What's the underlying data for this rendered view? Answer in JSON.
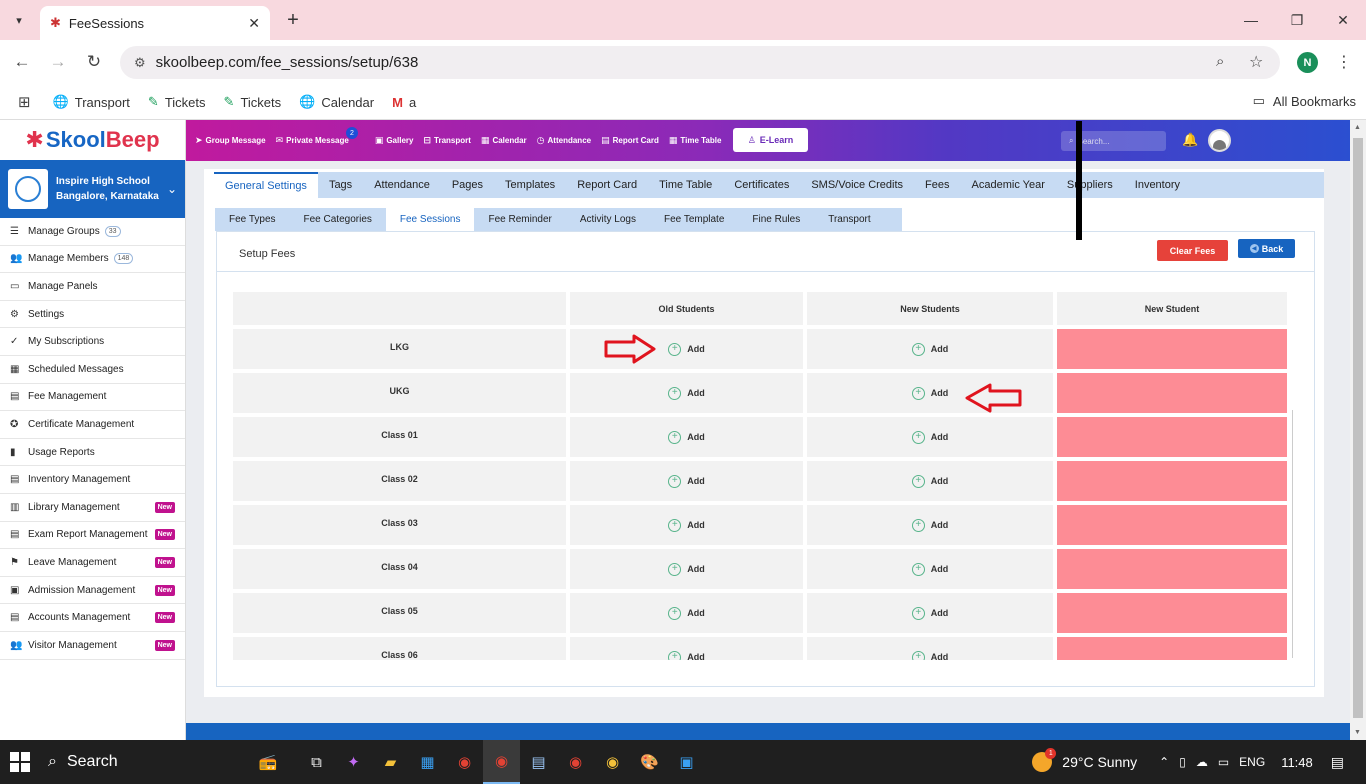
{
  "browser": {
    "tab_title": "FeeSessions",
    "url": "skoolbeep.com/fee_sessions/setup/638",
    "profile_initial": "N",
    "bookmarks": [
      "Transport",
      "Tickets",
      "Tickets",
      "Calendar",
      "a"
    ],
    "all_bookmarks": "All Bookmarks"
  },
  "app": {
    "logo_part1": "Skool",
    "logo_part2": "Beep",
    "school_name": "Inspire High School",
    "school_location": "Bangalore, Karnataka",
    "sidebar": [
      {
        "label": "Manage Groups",
        "count": "33",
        "icon": "list-icon"
      },
      {
        "label": "Manage Members",
        "count": "148",
        "icon": "users-icon"
      },
      {
        "label": "Manage Panels",
        "icon": "monitor-icon"
      },
      {
        "label": "Settings",
        "icon": "gear-icon"
      },
      {
        "label": "My Subscriptions",
        "icon": "check-icon"
      },
      {
        "label": "Scheduled Messages",
        "icon": "calendar-icon"
      },
      {
        "label": "Fee Management",
        "icon": "receipt-icon"
      },
      {
        "label": "Certificate Management",
        "icon": "ribbon-icon"
      },
      {
        "label": "Usage Reports",
        "icon": "bar-chart-icon"
      },
      {
        "label": "Inventory Management",
        "icon": "inventory-icon"
      },
      {
        "label": "Library Management",
        "badge": "New",
        "icon": "book-icon"
      },
      {
        "label": "Exam Report Management",
        "badge": "New",
        "icon": "report-icon"
      },
      {
        "label": "Leave Management",
        "badge": "New",
        "icon": "leave-icon"
      },
      {
        "label": "Admission Management",
        "badge": "New",
        "icon": "admission-icon"
      },
      {
        "label": "Accounts Management",
        "badge": "New",
        "icon": "accounts-icon"
      },
      {
        "label": "Visitor Management",
        "badge": "New",
        "icon": "visitor-icon"
      }
    ],
    "topnav": {
      "group_message": "Group Message",
      "private_message": "Private Message",
      "private_message_count": "2",
      "gallery": "Gallery",
      "transport": "Transport",
      "calendar": "Calendar",
      "attendance": "Attendance",
      "report_card": "Report Card",
      "time_table": "Time Table",
      "elearn": "E-Learn",
      "search_placeholder": "Search..."
    },
    "general_tabs": [
      "General Settings",
      "Tags",
      "Attendance",
      "Pages",
      "Templates",
      "Report Card",
      "Time Table",
      "Certificates",
      "SMS/Voice Credits",
      "Fees",
      "Academic Year",
      "Suppliers",
      "Inventory"
    ],
    "fee_tabs": [
      "Fee Types",
      "Fee Categories",
      "Fee Sessions",
      "Fee Reminder",
      "Activity Logs",
      "Fee Template",
      "Fine Rules",
      "Transport"
    ],
    "setup_title": "Setup Fees",
    "clear_fees": "Clear Fees",
    "back": "Back",
    "table": {
      "headers": [
        "",
        "Old Students",
        "New Students",
        "New Student"
      ],
      "add_label": "Add",
      "rows": [
        "LKG",
        "UKG",
        "Class 01",
        "Class 02",
        "Class 03",
        "Class 04",
        "Class 05",
        "Class 06"
      ]
    }
  },
  "taskbar": {
    "search": "Search",
    "weather_badge": "1",
    "weather": "29°C  Sunny",
    "lang": "ENG",
    "time": "11:48"
  },
  "colors": {
    "brand_blue": "#1764c0",
    "pink_cell": "#fd8c95",
    "clear_red": "#e6423a",
    "arrow_red": "#e0141e"
  }
}
